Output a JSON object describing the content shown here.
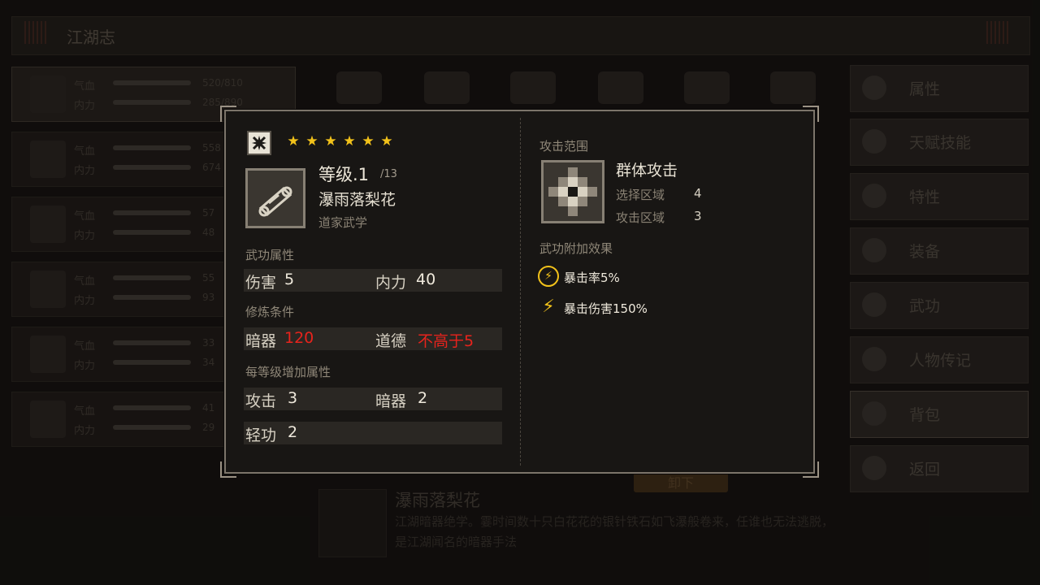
{
  "background": {
    "title": "江湖志",
    "characters": [
      {
        "stat1_label": "气血",
        "stat2_label": "内力",
        "stat1_value": "520/810",
        "stat2_value": "285/890",
        "selected": true
      },
      {
        "stat1_label": "气血",
        "stat2_label": "内力",
        "stat1_value": "558",
        "stat2_value": "674"
      },
      {
        "stat1_label": "气血",
        "stat2_label": "内力",
        "stat1_value": "57",
        "stat2_value": "48"
      },
      {
        "stat1_label": "气血",
        "stat2_label": "内力",
        "stat1_value": "55",
        "stat2_value": "93"
      },
      {
        "stat1_label": "气血",
        "stat2_label": "内力",
        "stat1_value": "33",
        "stat2_value": "34"
      },
      {
        "stat1_label": "气血",
        "stat2_label": "内力",
        "stat1_value": "41",
        "stat2_value": "29"
      }
    ],
    "menu": [
      {
        "label": "属性",
        "icon": "person-icon"
      },
      {
        "label": "天赋技能",
        "icon": "lightbulb-person-icon"
      },
      {
        "label": "特性",
        "icon": "person-badge-icon"
      },
      {
        "label": "装备",
        "icon": "sword-icon"
      },
      {
        "label": "武功",
        "icon": "scroll-icon"
      },
      {
        "label": "人物传记",
        "icon": "book-icon"
      },
      {
        "label": "背包",
        "icon": "bag-icon"
      },
      {
        "label": "返回",
        "icon": "door-icon"
      }
    ],
    "bottom_title": "瀑雨落梨花",
    "bottom_desc": "江湖暗器绝学。霎时间数十只白花花的银针铁石如飞瀑般卷来，任谁也无法逃脱，是江湖闻名的暗器手法",
    "equip_button": "卸下"
  },
  "modal": {
    "stars": 6,
    "star_glyph": "★",
    "level_label": "等级.1",
    "level_max": "/13",
    "skill_name": "瀑雨落梨花",
    "school": "道家武学",
    "sections": {
      "attributes": "武功属性",
      "requirements": "修炼条件",
      "per_level": "每等级增加属性"
    },
    "attributes": [
      {
        "label": "伤害",
        "value": "5"
      },
      {
        "label": "内力",
        "value": "40"
      }
    ],
    "requirements": [
      {
        "label": "暗器",
        "value": "120"
      },
      {
        "label": "道德",
        "value": "不高于5"
      }
    ],
    "per_level": [
      {
        "label": "攻击",
        "value": "3"
      },
      {
        "label": "暗器",
        "value": "2"
      },
      {
        "label": "轻功",
        "value": "2"
      }
    ],
    "range": {
      "title": "攻击范围",
      "name": "群体攻击",
      "select_label": "选择区域",
      "select_value": "4",
      "attack_label": "攻击区域",
      "attack_value": "3"
    },
    "bonus": {
      "title": "武功附加效果",
      "items": [
        {
          "text": "暴击率5%",
          "icon": "lightning-ring-icon"
        },
        {
          "text": "暴击伤害150%",
          "icon": "lightning-icon"
        }
      ]
    },
    "colors": {
      "star": "#f2c21a",
      "warning": "#e8231c",
      "frame": "#7c746a"
    }
  }
}
